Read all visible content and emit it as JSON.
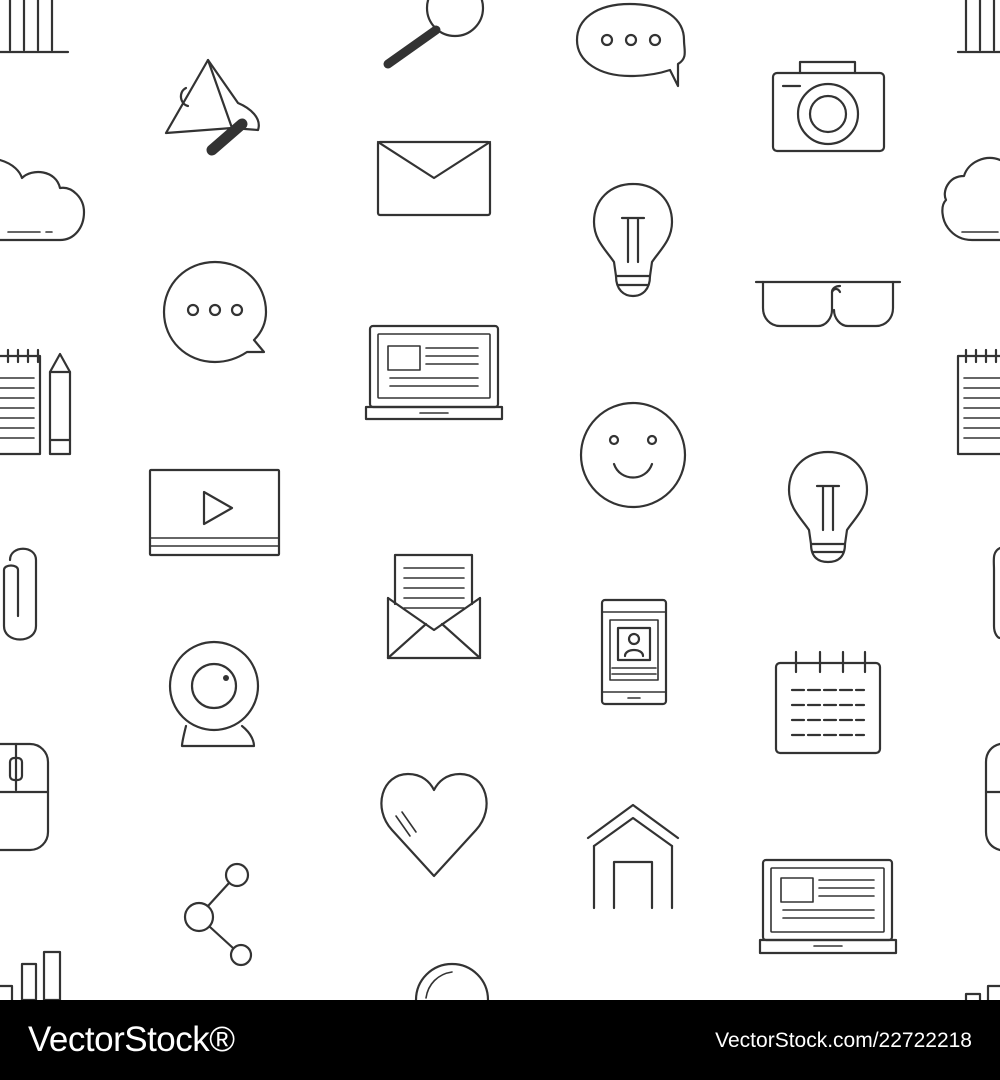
{
  "pattern": {
    "stroke_color": "#333333",
    "background_color": "#ffffff",
    "icons": [
      "bar-chart-icon",
      "magnifier-icon",
      "speech-bubble-icon",
      "camera-icon",
      "megaphone-icon",
      "envelope-icon",
      "cloud-icon",
      "lightbulb-icon",
      "glasses-icon",
      "laptop-icon",
      "notepad-pencil-icon",
      "smiley-icon",
      "video-player-icon",
      "paperclip-icon",
      "open-envelope-icon",
      "smartphone-profile-icon",
      "webcam-icon",
      "calendar-icon",
      "computer-mouse-icon",
      "heart-icon",
      "home-icon",
      "share-icon"
    ]
  },
  "watermark": {
    "brand": "VectorStock®",
    "code": "VectorStock.com/22722218",
    "bar_color": "#000000",
    "text_color": "#ffffff"
  }
}
